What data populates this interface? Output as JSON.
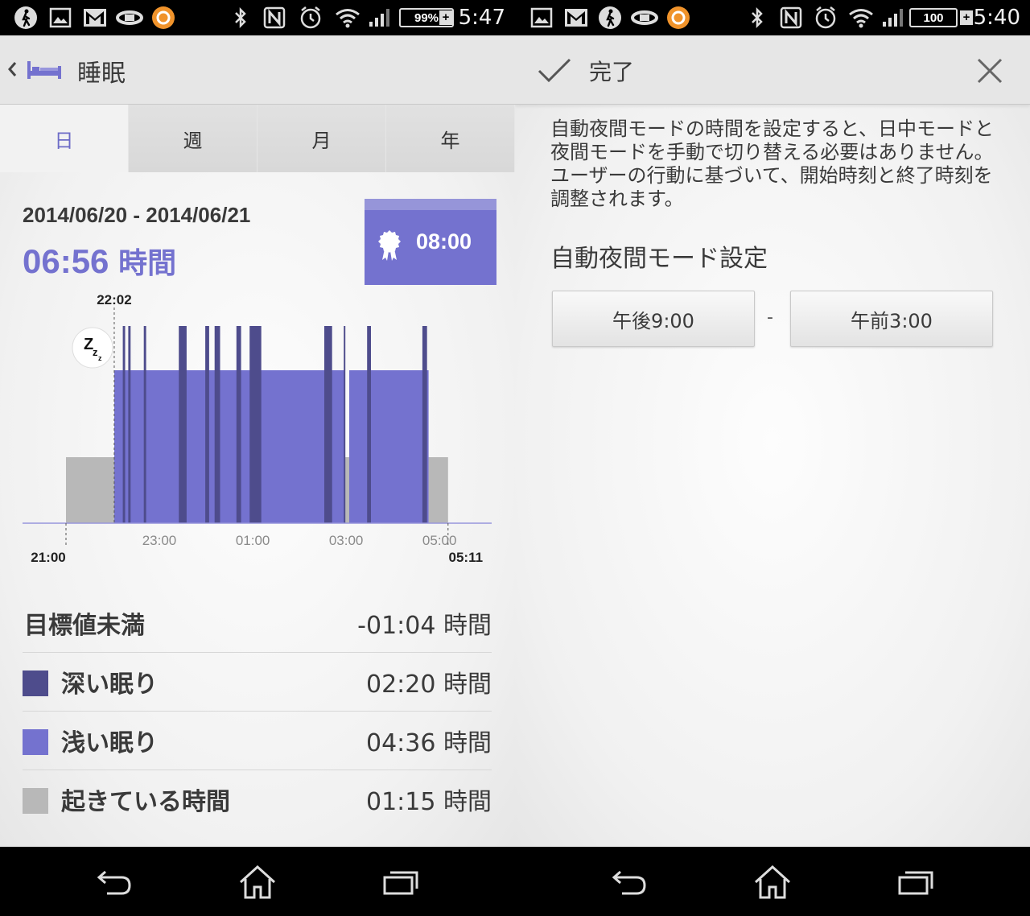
{
  "left": {
    "status": {
      "time": "5:47",
      "battery": "99%",
      "battery_plus": "+"
    },
    "header": {
      "title": "睡眠"
    },
    "tabs": [
      {
        "label": "日"
      },
      {
        "label": "週"
      },
      {
        "label": "月"
      },
      {
        "label": "年"
      }
    ],
    "date_range": "2014/06/20 - 2014/06/21",
    "total_sleep": {
      "value": "06:56",
      "unit": "時間"
    },
    "goal": {
      "value": "08:00"
    },
    "chart_data": {
      "type": "bar",
      "start_marker": "22:02",
      "axis_start": "21:00",
      "axis_end": "05:11",
      "tick_labels": [
        "23:00",
        "01:00",
        "03:00",
        "05:00"
      ],
      "series": [
        {
          "name": "深い眠り",
          "color": "#4e4c8c",
          "intervals": [
            [
              "22:13",
              "22:16"
            ],
            [
              "22:20",
              "22:23"
            ],
            [
              "22:40",
              "22:43"
            ],
            [
              "23:25",
              "23:35"
            ],
            [
              "23:59",
              "00:04"
            ],
            [
              "00:11",
              "00:18"
            ],
            [
              "00:39",
              "00:45"
            ],
            [
              "00:56",
              "01:11"
            ],
            [
              "02:32",
              "02:42"
            ],
            [
              "02:57",
              "02:59"
            ],
            [
              "03:27",
              "03:32"
            ],
            [
              "04:38",
              "04:44"
            ]
          ]
        },
        {
          "name": "浅い眠り",
          "color": "#7472cf",
          "intervals": [
            [
              "22:02",
              "02:58"
            ],
            [
              "03:04",
              "04:46"
            ]
          ]
        },
        {
          "name": "起きている時間",
          "color": "#b8b8b8",
          "intervals": [
            [
              "21:00",
              "22:02"
            ],
            [
              "02:58",
              "03:04"
            ],
            [
              "04:46",
              "05:11"
            ]
          ]
        }
      ]
    },
    "summary": {
      "below_goal": {
        "label": "目標値未満",
        "value": "-01:04 時間"
      },
      "deep": {
        "label": "深い眠り",
        "value": "02:20 時間",
        "color": "#4e4c8c"
      },
      "light": {
        "label": "浅い眠り",
        "value": "04:36 時間",
        "color": "#7472cf"
      },
      "awake": {
        "label": "起きている時間",
        "value": "01:15 時間",
        "color": "#b8b8b8"
      }
    }
  },
  "right": {
    "status": {
      "time": "5:40",
      "battery": "100",
      "battery_plus": "+"
    },
    "header": {
      "done_label": "完了"
    },
    "description": "自動夜間モードの時間を設定すると、日中モードと夜間モードを手動で切り替える必要はありません。ユーザーの行動に基づいて、開始時刻と終了時刻を調整されます。",
    "section_title": "自動夜間モード設定",
    "start_time": "午後9:00",
    "separator": "-",
    "end_time": "午前3:00"
  },
  "colors": {
    "accent": "#7472cf",
    "deep": "#4e4c8c",
    "awake": "#b8b8b8"
  }
}
